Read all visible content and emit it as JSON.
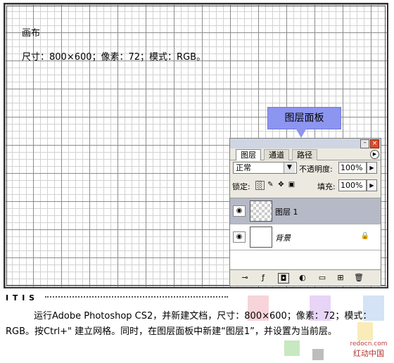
{
  "canvas": {
    "title": "画布",
    "info": "尺寸：800×600；像素：72；模式：RGB。"
  },
  "callout": {
    "label": "图层面板"
  },
  "panel": {
    "window_buttons": {
      "minimize": "–",
      "close": "×"
    },
    "tabs": [
      {
        "label": "图层"
      },
      {
        "label": "通道"
      },
      {
        "label": "路径"
      }
    ],
    "blend_mode": "正常",
    "opacity_label": "不透明度:",
    "opacity_value": "100%",
    "lock_label": "锁定:",
    "fill_label": "填充:",
    "fill_value": "100%",
    "layers": [
      {
        "name": "图层 1",
        "selected": true,
        "thumbnail": "transparent-checker"
      },
      {
        "name": "背景",
        "selected": false,
        "thumbnail": "white",
        "locked": true
      }
    ]
  },
  "tip": {
    "heading": "I T I S",
    "body": "运行Adobe Photoshop CS2，并新建文档，尺寸：800×600；像素：72；模式：RGB。按Ctrl+\" 建立网格。同时，在图层面板中新建“图层1”，并设置为当前层。"
  },
  "logo": {
    "url": "redocn.com",
    "name": "红动中国"
  },
  "colors": {
    "callout_bg": "#8c95f0",
    "selected_layer": "#b6b9c6",
    "panel_bg": "#ece9e0",
    "swatch_pink": "#f2b8c0",
    "swatch_purple": "#d9b8f0",
    "swatch_blue": "#b8d0f0",
    "swatch_yellow": "#f5e08a"
  }
}
